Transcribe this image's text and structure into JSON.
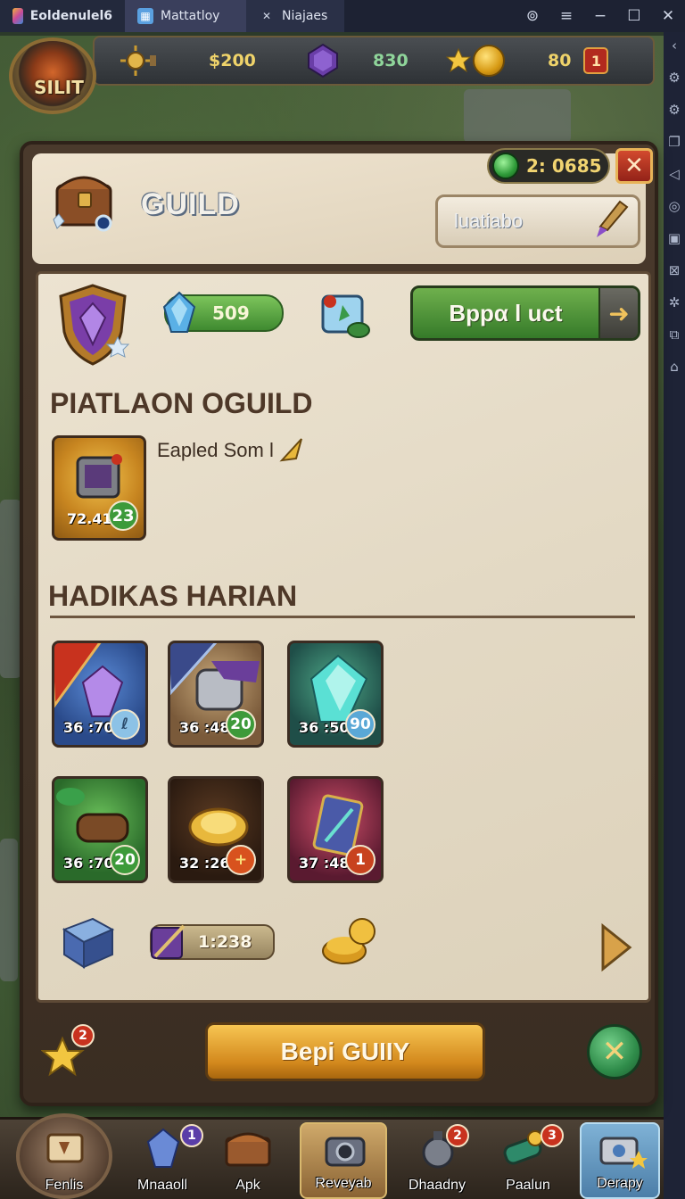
{
  "window": {
    "app_title": "Eoldenulel6",
    "tabs": [
      {
        "label": "Mattatloy",
        "active": true
      },
      {
        "label": "Niajaes",
        "active": false
      }
    ]
  },
  "player": {
    "avatar_label": "SILIT"
  },
  "resources": {
    "gold": "$200",
    "gems": "830",
    "coins": "80",
    "notification_count": "1"
  },
  "panel": {
    "title": "GUILD",
    "timer": "2: 0685",
    "search_placeholder": "luatiabo",
    "xp_value": "509",
    "action_button_label": "Bppα l uct",
    "section_guild_title": "PIATLAON OGUILD",
    "featured_item": {
      "qty": "72.41",
      "badge": "23"
    },
    "featured_label": "Eapled Som l",
    "section_rewards_title": "HADIKAS HARIAN",
    "items": [
      {
        "qty": "36 :70",
        "badge": "ℓ",
        "theme": "purple-gem"
      },
      {
        "qty": "36 :48",
        "badge": "20",
        "theme": "armor"
      },
      {
        "qty": "36 :50",
        "badge": "90",
        "theme": "teal-gem"
      },
      {
        "qty": "36 :70",
        "badge": "20",
        "theme": "scroll"
      },
      {
        "qty": "32 :26",
        "badge": "+",
        "theme": "gold-coin"
      },
      {
        "qty": "37 :48",
        "badge": "1",
        "theme": "spellbook"
      }
    ],
    "strip_value": "1:238",
    "footer_badge": "2",
    "primary_button_label": "Bepi GUIIY"
  },
  "bottom_nav": [
    {
      "label": "Fenlis",
      "badge": ""
    },
    {
      "label": "Mnaaoll",
      "badge": "1"
    },
    {
      "label": "Apk",
      "badge": ""
    },
    {
      "label": "Reveyab",
      "badge": ""
    },
    {
      "label": "Dhaadny",
      "badge": "2"
    },
    {
      "label": "Paalun",
      "badge": "3"
    },
    {
      "label": "Derapy",
      "badge": ""
    }
  ],
  "colors": {
    "panel_parchment": "#e6dcc8",
    "green_button": "#4f9a3a",
    "gold_button": "#e0a034",
    "close_red": "#c0392b",
    "tab_bar": "#1d2233"
  }
}
